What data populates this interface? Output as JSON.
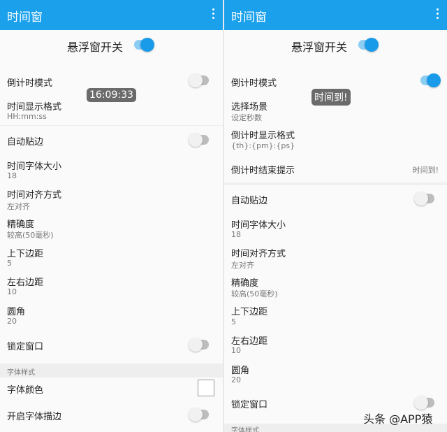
{
  "left": {
    "app_title": "时间窗",
    "master_label": "悬浮窗开关",
    "float_time": "16:09:33",
    "items": [
      {
        "title": "倒计时模式"
      },
      {
        "title": "时间显示格式",
        "sub": "HH:mm:ss"
      },
      {
        "title": "自动贴边"
      },
      {
        "title": "时间字体大小",
        "sub": "18"
      },
      {
        "title": "时间对齐方式",
        "sub": "左对齐"
      },
      {
        "title": "精确度",
        "sub": "较高(50毫秒)"
      },
      {
        "title": "上下边距",
        "sub": "5"
      },
      {
        "title": "左右边距",
        "sub": "10"
      },
      {
        "title": "圆角",
        "sub": "20"
      },
      {
        "title": "锁定窗口"
      },
      {
        "title": "字体颜色"
      },
      {
        "title": "开启字体描边"
      }
    ],
    "section": "字体样式",
    "toggles": {
      "master": true,
      "countdown": false,
      "auto_edge": false,
      "lock": false,
      "stroke": false
    }
  },
  "right": {
    "app_title": "时间窗",
    "master_label": "悬浮窗开关",
    "float_text": "时间到!",
    "items": [
      {
        "title": "倒计时模式"
      },
      {
        "title": "选择场景",
        "sub": "设定秒数"
      },
      {
        "title": "倒计时显示格式",
        "sub": "{th}:{pm}:{ps}"
      },
      {
        "title": "倒计时结束提示",
        "value": "时间到!"
      },
      {
        "title": "自动贴边"
      },
      {
        "title": "时间字体大小",
        "sub": "18"
      },
      {
        "title": "时间对齐方式",
        "sub": "左对齐"
      },
      {
        "title": "精确度",
        "sub": "较高(50毫秒)"
      },
      {
        "title": "上下边距",
        "sub": "5"
      },
      {
        "title": "左右边距",
        "sub": "10"
      },
      {
        "title": "圆角",
        "sub": "20"
      },
      {
        "title": "锁定窗口"
      }
    ],
    "section": "字体样式",
    "toggles": {
      "master": true,
      "countdown": true,
      "auto_edge": false,
      "lock": false
    }
  },
  "watermark": "头条 @APP猿",
  "colors": {
    "accent": "#1ba1ec"
  }
}
